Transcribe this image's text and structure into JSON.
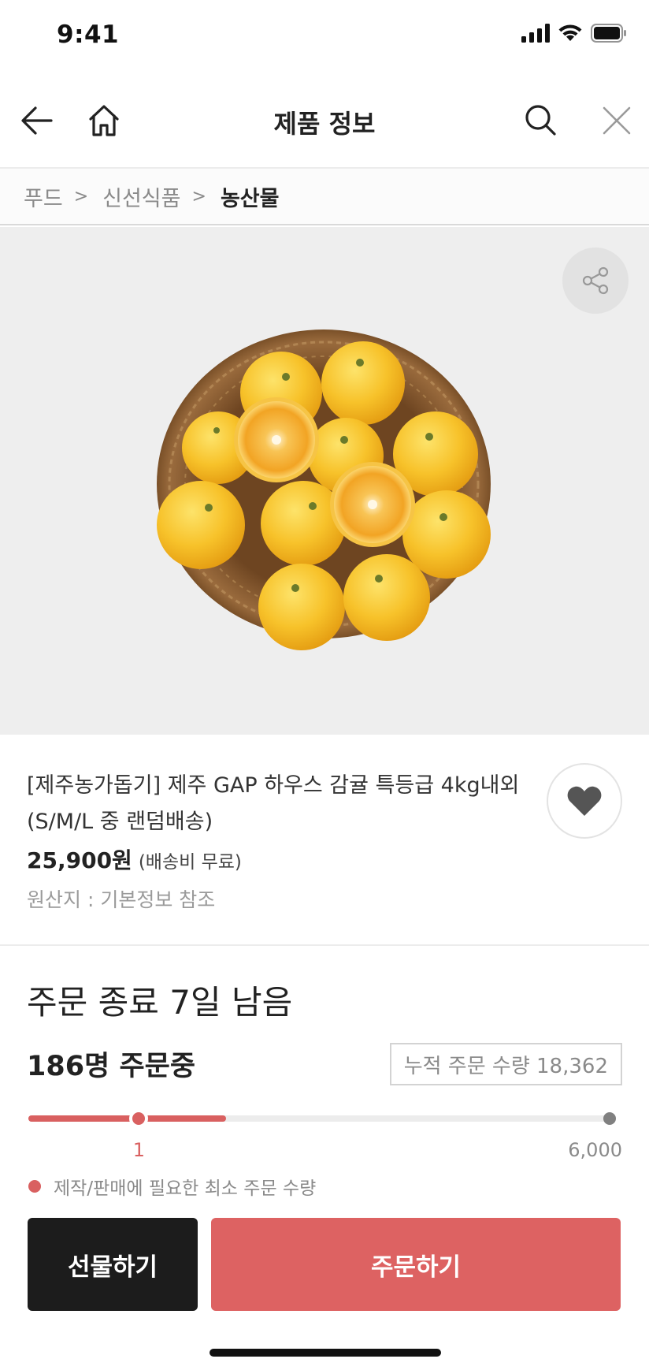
{
  "status_bar": {
    "time": "9:41",
    "icons": [
      "cellular-signal-icon",
      "wifi-icon",
      "battery-icon"
    ]
  },
  "nav": {
    "title": "제품 정보",
    "icons": [
      "back-arrow-icon",
      "home-icon",
      "search-icon",
      "close-icon"
    ]
  },
  "breadcrumb": {
    "items": [
      "푸드",
      "신선식품",
      "농산물"
    ],
    "separator": ">"
  },
  "hero": {
    "image_alt": "바구니에 담긴 감귤",
    "share_icon": "share-icon"
  },
  "product": {
    "name": "[제주농가돕기] 제주 GAP 하우스 감귤 특등급 4kg내외 (S/M/L 중 랜덤배송)",
    "price": "25,900원",
    "shipping": "(배송비 무료)",
    "origin": "원산지 : 기본정보 참조",
    "wish_icon": "heart-icon"
  },
  "order_status": {
    "deadline": "주문 종료 7일 남음",
    "ordering": "186명 주문중",
    "cumulative": "누적 주문 수량 18,362",
    "min_label": "1",
    "max_label": "6,000",
    "progress_fraction": 0.34,
    "min_marker_fraction": 0.19,
    "legend": "제작/판매에 필요한 최소 주문 수량"
  },
  "actions": {
    "gift_label": "선물하기",
    "order_label": "주문하기"
  },
  "colors": {
    "accent": "#dd6262",
    "dark_button": "#1c1c1c",
    "hero_background": "#eeeeee"
  }
}
